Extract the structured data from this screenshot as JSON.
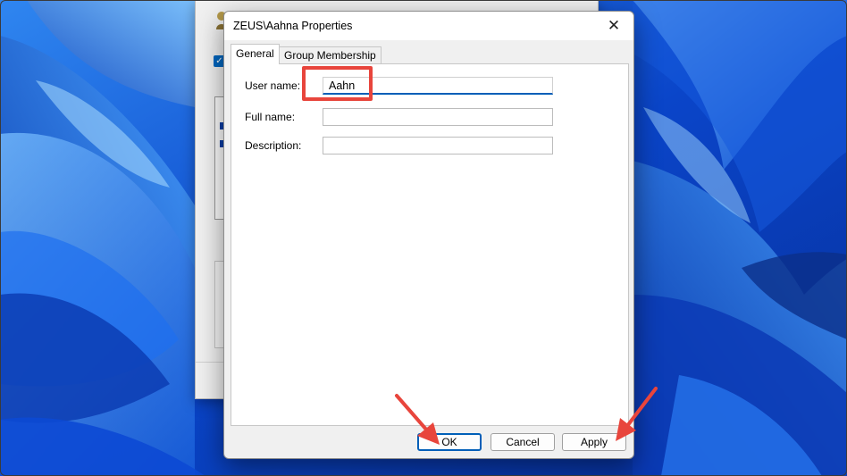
{
  "dialog": {
    "title": "ZEUS\\Aahna Properties",
    "close_glyph": "✕",
    "tabs": [
      {
        "label": "General",
        "active": true
      },
      {
        "label": "Group Membership",
        "active": false
      }
    ],
    "fields": {
      "user_name": {
        "label": "User name:",
        "value": "Aahn"
      },
      "full_name": {
        "label": "Full name:",
        "value": ""
      },
      "description": {
        "label": "Description:",
        "value": ""
      }
    },
    "buttons": {
      "ok": "OK",
      "cancel": "Cancel",
      "apply": "Apply"
    }
  },
  "background_window": {
    "checkbox_checked": true,
    "checkbox_glyph": "✓"
  },
  "colors": {
    "accent": "#005fb8",
    "annotation": "#e8453c",
    "wallpaper_base": "#0a45c9"
  }
}
